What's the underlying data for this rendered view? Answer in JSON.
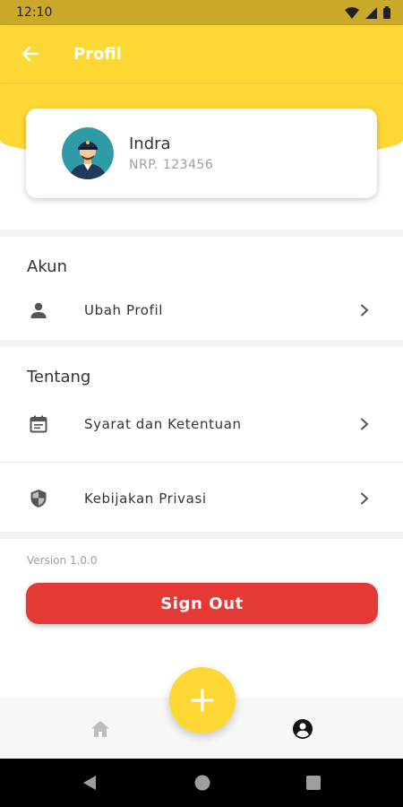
{
  "status_bar": {
    "time": "12:10"
  },
  "app_bar": {
    "title": "Profil"
  },
  "profile": {
    "name": "Indra",
    "nrp": "NRP. 123456"
  },
  "sections": {
    "akun": {
      "title": "Akun",
      "items": [
        {
          "label": "Ubah Profil",
          "icon": "person-icon"
        }
      ]
    },
    "tentang": {
      "title": "Tentang",
      "items": [
        {
          "label": "Syarat dan Ketentuan",
          "icon": "calendar-icon"
        },
        {
          "label": "Kebijakan Privasi",
          "icon": "shield-icon"
        }
      ]
    }
  },
  "version": "Version 1.0.0",
  "sign_out_label": "Sign Out",
  "colors": {
    "primary": "#fdd835",
    "danger": "#e53935",
    "status_bar": "#c9a82a"
  },
  "bottom_nav": {
    "items": [
      {
        "icon": "home-icon",
        "active": false
      },
      {
        "icon": "account-circle-icon",
        "active": true
      }
    ]
  }
}
